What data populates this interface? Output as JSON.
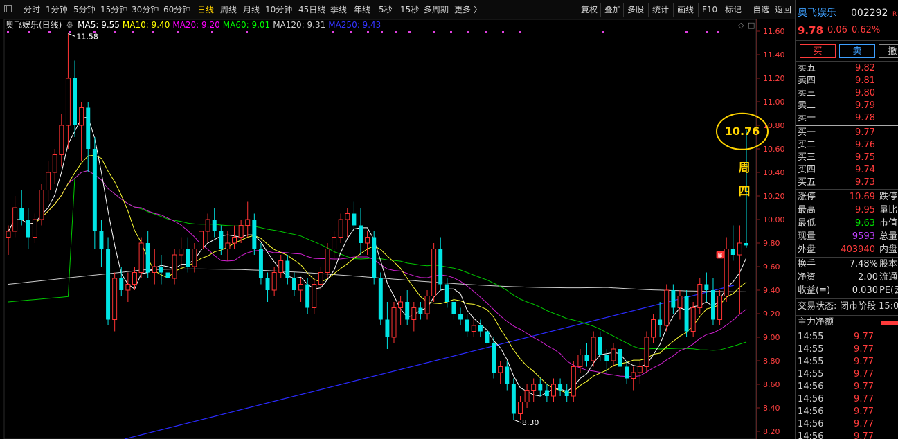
{
  "toolbar": {
    "tabs": [
      "分时",
      "1分钟",
      "5分钟",
      "15分钟",
      "30分钟",
      "60分钟",
      "日线",
      "周线",
      "月线",
      "10分钟",
      "45日线",
      "季线",
      "年线",
      "5秒",
      "15秒",
      "多周期",
      "更多 〉"
    ],
    "active_tab": "日线",
    "buttons": [
      "复权",
      "叠加",
      "多股",
      "统计",
      "画线",
      "F10",
      "标记",
      "-自选",
      "返回"
    ]
  },
  "indicators": {
    "stock_label": "奥飞娱乐(日线)",
    "items": [
      {
        "text": "MA5: 9.55",
        "color": "#ffffff"
      },
      {
        "text": "MA10: 9.40",
        "color": "#ffff00"
      },
      {
        "text": "MA20: 9.20",
        "color": "#ff00ff"
      },
      {
        "text": "MA60: 9.01",
        "color": "#00ff00"
      },
      {
        "text": "MA120: 9.31",
        "color": "#d0d0d0"
      },
      {
        "text": "MA250: 9.43",
        "color": "#3333ff"
      }
    ]
  },
  "price_axis": [
    "11.60",
    "11.40",
    "11.20",
    "11.00",
    "10.80",
    "10.60",
    "10.40",
    "10.20",
    "10.00",
    "9.80",
    "9.60",
    "9.40",
    "9.20",
    "9.00",
    "8.80",
    "8.60",
    "8.40",
    "8.20"
  ],
  "annotations": {
    "high_label": "11.58",
    "low_label": "8.30",
    "circled_value": "10.76",
    "weekday_1": "周",
    "weekday_2": "四",
    "b_marker": "B"
  },
  "chart_data": {
    "type": "candlestick",
    "ylim": [
      8.2,
      11.7
    ],
    "high": 11.58,
    "low": 8.3,
    "candles": [
      [
        9.85,
        9.95,
        9.7,
        9.9
      ],
      [
        9.9,
        10.2,
        9.85,
        10.1
      ],
      [
        10.1,
        10.25,
        9.95,
        10.0
      ],
      [
        10.0,
        10.1,
        9.75,
        9.85
      ],
      [
        9.85,
        10.05,
        9.8,
        10.0
      ],
      [
        10.0,
        10.3,
        9.95,
        10.25
      ],
      [
        10.25,
        10.5,
        10.15,
        10.4
      ],
      [
        10.4,
        10.6,
        10.3,
        10.55
      ],
      [
        10.55,
        10.9,
        10.45,
        10.8
      ],
      [
        10.8,
        11.58,
        10.6,
        11.2
      ],
      [
        11.2,
        11.35,
        10.7,
        10.8
      ],
      [
        10.8,
        11.0,
        10.5,
        10.95
      ],
      [
        10.95,
        11.0,
        10.4,
        10.6
      ],
      [
        10.6,
        10.7,
        9.75,
        9.9
      ],
      [
        9.9,
        10.0,
        9.6,
        9.75
      ],
      [
        9.75,
        9.85,
        9.1,
        9.15
      ],
      [
        9.15,
        9.55,
        9.05,
        9.5
      ],
      [
        9.5,
        9.6,
        9.35,
        9.4
      ],
      [
        9.4,
        9.55,
        9.3,
        9.45
      ],
      [
        9.45,
        9.6,
        9.4,
        9.55
      ],
      [
        9.55,
        9.85,
        9.5,
        9.8
      ],
      [
        9.8,
        9.9,
        9.5,
        9.55
      ],
      [
        9.55,
        9.75,
        9.45,
        9.6
      ],
      [
        9.6,
        9.7,
        9.45,
        9.55
      ],
      [
        9.55,
        9.65,
        9.4,
        9.5
      ],
      [
        9.5,
        9.75,
        9.45,
        9.7
      ],
      [
        9.7,
        9.85,
        9.6,
        9.75
      ],
      [
        9.75,
        9.85,
        9.55,
        9.6
      ],
      [
        9.6,
        9.8,
        9.55,
        9.75
      ],
      [
        9.75,
        9.95,
        9.7,
        9.9
      ],
      [
        9.9,
        10.05,
        9.8,
        10.0
      ],
      [
        10.0,
        10.1,
        9.85,
        9.9
      ],
      [
        9.9,
        9.95,
        9.7,
        9.75
      ],
      [
        9.75,
        9.9,
        9.65,
        9.8
      ],
      [
        9.8,
        9.95,
        9.75,
        9.85
      ],
      [
        9.85,
        10.0,
        9.8,
        9.95
      ],
      [
        9.95,
        10.15,
        9.85,
        10.0
      ],
      [
        10.0,
        10.05,
        9.7,
        9.75
      ],
      [
        9.75,
        9.8,
        9.45,
        9.5
      ],
      [
        9.5,
        9.55,
        9.3,
        9.4
      ],
      [
        9.4,
        9.6,
        9.35,
        9.55
      ],
      [
        9.55,
        9.7,
        9.5,
        9.65
      ],
      [
        9.65,
        9.7,
        9.45,
        9.5
      ],
      [
        9.5,
        9.55,
        9.35,
        9.4
      ],
      [
        9.4,
        9.5,
        9.3,
        9.45
      ],
      [
        9.45,
        9.5,
        9.2,
        9.25
      ],
      [
        9.25,
        9.5,
        9.2,
        9.45
      ],
      [
        9.45,
        9.6,
        9.4,
        9.55
      ],
      [
        9.55,
        9.8,
        9.5,
        9.75
      ],
      [
        9.75,
        9.9,
        9.65,
        9.85
      ],
      [
        9.85,
        10.05,
        9.8,
        10.0
      ],
      [
        10.0,
        10.1,
        9.85,
        10.05
      ],
      [
        10.05,
        10.15,
        9.9,
        9.95
      ],
      [
        9.95,
        10.1,
        9.7,
        9.8
      ],
      [
        9.8,
        9.9,
        9.7,
        9.85
      ],
      [
        9.85,
        9.9,
        9.45,
        9.5
      ],
      [
        9.5,
        9.55,
        9.1,
        9.15
      ],
      [
        9.15,
        9.3,
        8.9,
        9.0
      ],
      [
        9.0,
        9.3,
        8.95,
        9.25
      ],
      [
        9.25,
        9.35,
        9.1,
        9.3
      ],
      [
        9.3,
        9.4,
        9.1,
        9.15
      ],
      [
        9.15,
        9.3,
        9.05,
        9.25
      ],
      [
        9.25,
        9.3,
        9.15,
        9.2
      ],
      [
        9.2,
        9.4,
        9.15,
        9.35
      ],
      [
        9.35,
        9.8,
        9.3,
        9.75
      ],
      [
        9.75,
        9.85,
        9.4,
        9.45
      ],
      [
        9.45,
        9.5,
        9.25,
        9.3
      ],
      [
        9.3,
        9.35,
        9.15,
        9.2
      ],
      [
        9.2,
        9.25,
        9.1,
        9.15
      ],
      [
        9.15,
        9.2,
        9.0,
        9.05
      ],
      [
        9.05,
        9.15,
        9.0,
        9.1
      ],
      [
        9.1,
        9.15,
        9.0,
        9.05
      ],
      [
        9.05,
        9.1,
        8.9,
        8.95
      ],
      [
        8.95,
        9.0,
        8.65,
        8.7
      ],
      [
        8.7,
        8.8,
        8.6,
        8.75
      ],
      [
        8.75,
        8.8,
        8.55,
        8.6
      ],
      [
        8.6,
        8.65,
        8.3,
        8.35
      ],
      [
        8.35,
        8.5,
        8.3,
        8.45
      ],
      [
        8.45,
        8.6,
        8.4,
        8.55
      ],
      [
        8.55,
        8.65,
        8.45,
        8.6
      ],
      [
        8.6,
        8.65,
        8.5,
        8.55
      ],
      [
        8.55,
        8.6,
        8.45,
        8.5
      ],
      [
        8.5,
        8.65,
        8.45,
        8.6
      ],
      [
        8.6,
        8.65,
        8.5,
        8.55
      ],
      [
        8.55,
        8.6,
        8.45,
        8.5
      ],
      [
        8.5,
        8.8,
        8.45,
        8.75
      ],
      [
        8.75,
        8.9,
        8.7,
        8.85
      ],
      [
        8.85,
        8.95,
        8.75,
        8.8
      ],
      [
        8.8,
        9.05,
        8.75,
        9.0
      ],
      [
        9.0,
        9.05,
        8.8,
        8.85
      ],
      [
        8.85,
        8.9,
        8.7,
        8.8
      ],
      [
        8.8,
        8.95,
        8.75,
        8.9
      ],
      [
        8.9,
        8.95,
        8.7,
        8.75
      ],
      [
        8.75,
        8.8,
        8.6,
        8.65
      ],
      [
        8.65,
        8.75,
        8.55,
        8.7
      ],
      [
        8.7,
        8.8,
        8.6,
        8.75
      ],
      [
        8.75,
        9.05,
        8.7,
        9.0
      ],
      [
        9.0,
        9.2,
        8.95,
        9.15
      ],
      [
        9.15,
        9.3,
        9.0,
        9.1
      ],
      [
        9.1,
        9.45,
        9.05,
        9.4
      ],
      [
        9.4,
        9.45,
        9.2,
        9.25
      ],
      [
        9.25,
        9.4,
        9.15,
        9.35
      ],
      [
        9.35,
        9.4,
        9.0,
        9.05
      ],
      [
        9.05,
        9.3,
        9.0,
        9.25
      ],
      [
        9.25,
        9.5,
        9.2,
        9.45
      ],
      [
        9.45,
        9.55,
        9.3,
        9.4
      ],
      [
        9.4,
        9.5,
        9.1,
        9.15
      ],
      [
        9.15,
        9.4,
        9.1,
        9.35
      ],
      [
        9.35,
        9.85,
        9.3,
        9.75
      ],
      [
        9.75,
        9.95,
        9.65,
        9.7
      ],
      [
        9.7,
        9.95,
        9.2,
        9.8
      ],
      [
        9.8,
        10.76,
        9.76,
        9.78
      ]
    ]
  },
  "panel": {
    "name": "奥飞娱乐",
    "code": "002292",
    "code_badge": "R",
    "price": "9.78",
    "change": "0.06",
    "change_pct": "0.62%",
    "buttons": [
      "买",
      "卖",
      "撤"
    ],
    "asks": [
      {
        "label": "卖五",
        "price": "9.82"
      },
      {
        "label": "卖四",
        "price": "9.81"
      },
      {
        "label": "卖三",
        "price": "9.80"
      },
      {
        "label": "卖二",
        "price": "9.79"
      },
      {
        "label": "卖一",
        "price": "9.78"
      }
    ],
    "bids": [
      {
        "label": "买一",
        "price": "9.77"
      },
      {
        "label": "买二",
        "price": "9.76"
      },
      {
        "label": "买三",
        "price": "9.75"
      },
      {
        "label": "买四",
        "price": "9.74"
      },
      {
        "label": "买五",
        "price": "9.73"
      }
    ],
    "stats": [
      {
        "label": "涨停",
        "value": "10.69",
        "extra": "跌停",
        "color": "#ff3b3b"
      },
      {
        "label": "最高",
        "value": "9.95",
        "extra": "量比",
        "color": "#ff3b3b"
      },
      {
        "label": "最低",
        "value": "9.63",
        "extra": "市值",
        "color": "#00e000"
      },
      {
        "label": "现量",
        "value": "9593",
        "extra": "总量",
        "color": "#c040ff"
      },
      {
        "label": "外盘",
        "value": "403940",
        "extra": "内盘",
        "color": "#ff3b3b"
      }
    ],
    "fin": [
      {
        "label": "换手",
        "value": "7.48%",
        "extra": "股本"
      },
      {
        "label": "净资",
        "value": "2.00",
        "extra": "流通"
      },
      {
        "label": "收益(≡)",
        "value": "0.030",
        "extra": "PE(云"
      }
    ],
    "status_label": "交易状态:",
    "status_value": "闭市阶段 15:0",
    "flow_label": "主力净额",
    "ticks": [
      {
        "time": "14:55",
        "price": "9.77"
      },
      {
        "time": "14:55",
        "price": "9.77"
      },
      {
        "time": "14:55",
        "price": "9.77"
      },
      {
        "time": "14:55",
        "price": "9.77"
      },
      {
        "time": "14:56",
        "price": "9.77"
      },
      {
        "time": "14:56",
        "price": "9.77"
      },
      {
        "time": "14:56",
        "price": "9.77"
      },
      {
        "time": "14:56",
        "price": "9.77"
      },
      {
        "time": "14:56",
        "price": "9.77"
      }
    ]
  }
}
